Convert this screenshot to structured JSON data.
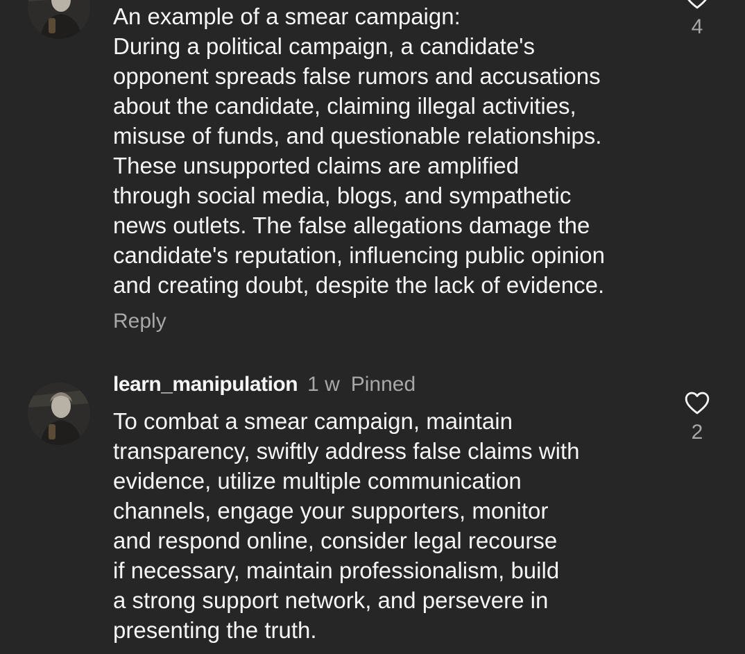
{
  "comments": [
    {
      "text_lines": [
        "An example of a smear campaign:",
        "During a political campaign, a candidate's",
        "opponent spreads false rumors and accusations",
        "about the candidate, claiming illegal activities,",
        "misuse of funds, and questionable relationships.",
        "These unsupported claims are amplified",
        "through social media, blogs, and sympathetic",
        "news outlets. The false allegations damage the",
        "candidate's reputation, influencing public opinion",
        "and creating doubt, despite the lack of evidence."
      ],
      "reply_label": "Reply",
      "like_count": "4",
      "avatar_icon": "profile-avatar"
    },
    {
      "username": "learn_manipulation",
      "time": "1 w",
      "pinned_label": "Pinned",
      "text_lines": [
        "To combat a smear campaign, maintain",
        "transparency, swiftly address false claims with",
        "evidence, utilize multiple communication",
        "channels, engage your supporters, monitor",
        "and respond online, consider legal recourse",
        "if necessary, maintain professionalism, build",
        "a strong support network, and persevere in",
        "presenting the truth."
      ],
      "like_count": "2",
      "avatar_icon": "profile-avatar"
    }
  ],
  "colors": {
    "background": "#262626",
    "primary_text": "#f5f5f5",
    "secondary_text": "#a8a8a8"
  },
  "icons": {
    "like": "heart-outline-icon"
  }
}
